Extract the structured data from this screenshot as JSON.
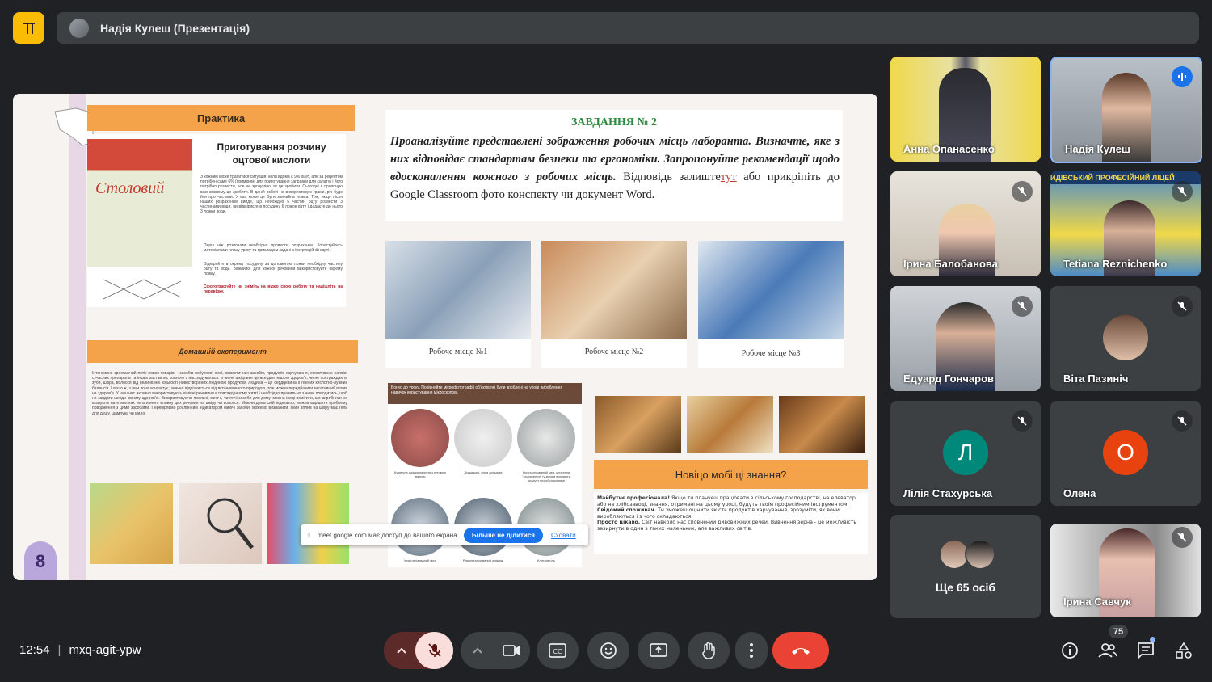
{
  "top": {
    "presenter": "Надія Кулеш (Презентація)"
  },
  "slide": {
    "left": {
      "practice_title": "Практика",
      "recipe_title": "Приготування розчину оцтової кислоти",
      "brand_text": "Столовий",
      "recipe_body": "З кожним може трапитися ситуація, коли вдома є 9% оцет, але за рецептом потрібен саме 6% (приміром, для приготування заправки для салату) і його потрібно розвести, але не зрозуміло, як це зробити. Сьогодні я пропоную вам кожному це зробити. В даній роботі не використовую грами, річ буде йти про частини. У вас може це бути звичайна ложка. Тож, якщо після наших розрахунків вийде, що необхідно 6 частин оцту розвести 3 частинами води, ви відміряєте в посудину 6 ложок оцту і додаєте до нього 3 ложки води.",
      "recipe_step1": "Перш ніж розпочати необхідно провести розрахунки. Користуйтесь матеріалами плану уроку та прикладом задачі в інструкційній карті.",
      "recipe_step2": "Відміряйте в окрему посудину за допомогою ложки необхідну частину оцту та води. Важливо! Для кожної речовини використовуйте окрему ложку.",
      "recipe_step3": "Сфотографуйте чи зніміть на відео свою роботу та надішліть на перевірку.",
      "home_title": "Домашній експеримент",
      "home_body": "Інтенсивно зростаючий потік нових товарів – засобів побутової хімії, косметичних засобів, продуктів харчування, ефективних напоїв, сучасних препаратів та інших заставляє кожного з нас задуматися: а чи не шкідливе це все для нашого здоров'я, чи не постраждають зуби, шкіра, волосся від величезної кількості новостворених людиною продуктів. Людина – це сердцевина її генних кислотно-лужних балансів. І якщо ж, з чим вона контактує, значно відрізняється від встановленого природою, тож можна передбачити негативний вплив на здоров'я. У наш час активно використовують хімічні речовини в повсякденному житті і необхідно правильно з ними поводитись, щоб не завдати шкоди своєму здоров'ю. Використовуючи пральні, миючі, чистячі засоби для дому, можна іноді помітити, що виробники не вказують на етикетках негативного впливу цих речовин на шкіру чи волосся. Маючи дома свій індикатор, можна вирішити проблему поводження з цими засобами. Перевіряємо рослинним індикатором миючі засоби, можемо визначити, який вплив на шкіру має гель для душу, шампунь чи мило.",
      "page_number": "8"
    },
    "task": {
      "title": "ЗАВДАННЯ № 2",
      "body_italic": "Проаналізуйте представлені зображення робочих місць лаборанта. Визначте, яке з них відповідає стандартам безпеки та ергономіки. Запропонуйте рекомендації щодо вдосконалення кожного з робочих місць.",
      "body_plain_1": "Відповідь залиште",
      "body_link": "тут",
      "body_plain_2": "або прикріпіть до Google Classroom фото конспекту чи документ Word."
    },
    "workplaces": [
      "Робоче місце №1",
      "Робоче місце №2",
      "Робоче місце №3"
    ],
    "micro": {
      "header": "Бонус до уроку. Порівняйте мікрофотографії об'єктів які були зроблені на уроці вироблення навичок користування мікроскопом.",
      "captions": [
        "Кутикула шкірки насіння з кутовою зміною",
        "Дріжджові, гілки дріжджів",
        "Кристалізований мед, кристали \"зацукрення\" (у кіосків визнають продукт недоброякісним)",
        "Кристалізований мед",
        "Рекристалізований дріжджі",
        "Клітини гіль"
      ]
    },
    "news": {
      "title": "Новіцо мобі ці знання?",
      "p1_label": "Майбутнє професіонала!",
      "p1": "Якщо ти плануєш працювати в сільському господарстві, на елеваторі або на хлібозаводі, знання, отримані на цьому уроці, будуть твоїм професійним інструментом.",
      "p2_label": "Свідомий споживач.",
      "p2": "Ти зможеш оцінити якість продуктів харчування, зрозуміти, як вони виробляються і з чого складаються.",
      "p3_label": "Просто цікаво.",
      "p3": "Світ навколо нас сповнений дивовижних речей. Вивчення зерна - це можливість зазирнути в один з таких маленьких, але важливих світів."
    },
    "share_notice": {
      "text": "meet.google.com має доступ до вашого екрана.",
      "stop_label": "Більше не ділитися",
      "hide_label": "Сховати"
    }
  },
  "participants": [
    {
      "name": "Анна Опанасенко"
    },
    {
      "name": "Надія Кулеш"
    },
    {
      "name": "Ірина Балобанова"
    },
    {
      "name": "Tetiana Reznichenko"
    },
    {
      "name": "Едуард Гончаров"
    },
    {
      "name": "Віта Пазиніч"
    },
    {
      "name": "Лілія Стахурська",
      "initial": "Л",
      "color": "#00897b"
    },
    {
      "name": "Олена",
      "initial": "О",
      "color": "#e8430e"
    },
    {
      "name": "Ще 65 осіб"
    },
    {
      "name": "Ірина Савчук"
    }
  ],
  "tile_banner": "ИДІВСЬКИЙ ПРОФЕСІЙНИЙ ЛІЦЕЙ",
  "bottom": {
    "time": "12:54",
    "separator": "|",
    "meeting_code": "mxq-agit-ypw",
    "people_count": "75"
  },
  "colors": {
    "accent_orange": "#f5a34a",
    "end_call_red": "#ea4335",
    "mic_off_bg": "#f9dedc",
    "link_blue": "#1a73e8"
  }
}
